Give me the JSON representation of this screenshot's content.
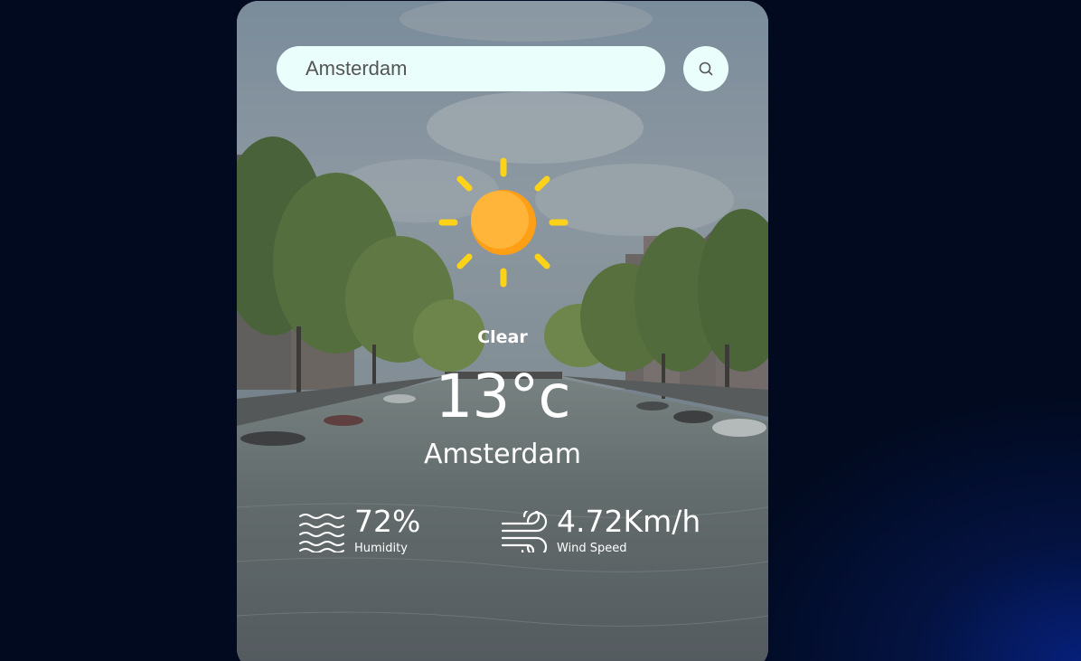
{
  "search": {
    "value": "Amsterdam",
    "placeholder": "",
    "button_icon": "search-icon"
  },
  "weather": {
    "icon": "sun-icon",
    "condition": "Clear",
    "temperature": "13°c",
    "city": "Amsterdam"
  },
  "details": {
    "humidity": {
      "value": "72%",
      "label": "Humidity",
      "icon": "humidity-waves-icon"
    },
    "wind": {
      "value": "4.72Km/h",
      "label": "Wind Speed",
      "icon": "wind-icon"
    }
  },
  "colors": {
    "page_background": "#010a1e",
    "input_background": "#eafffb",
    "sun_core": "#ffab2e",
    "sun_rays": "#ffd21a"
  }
}
